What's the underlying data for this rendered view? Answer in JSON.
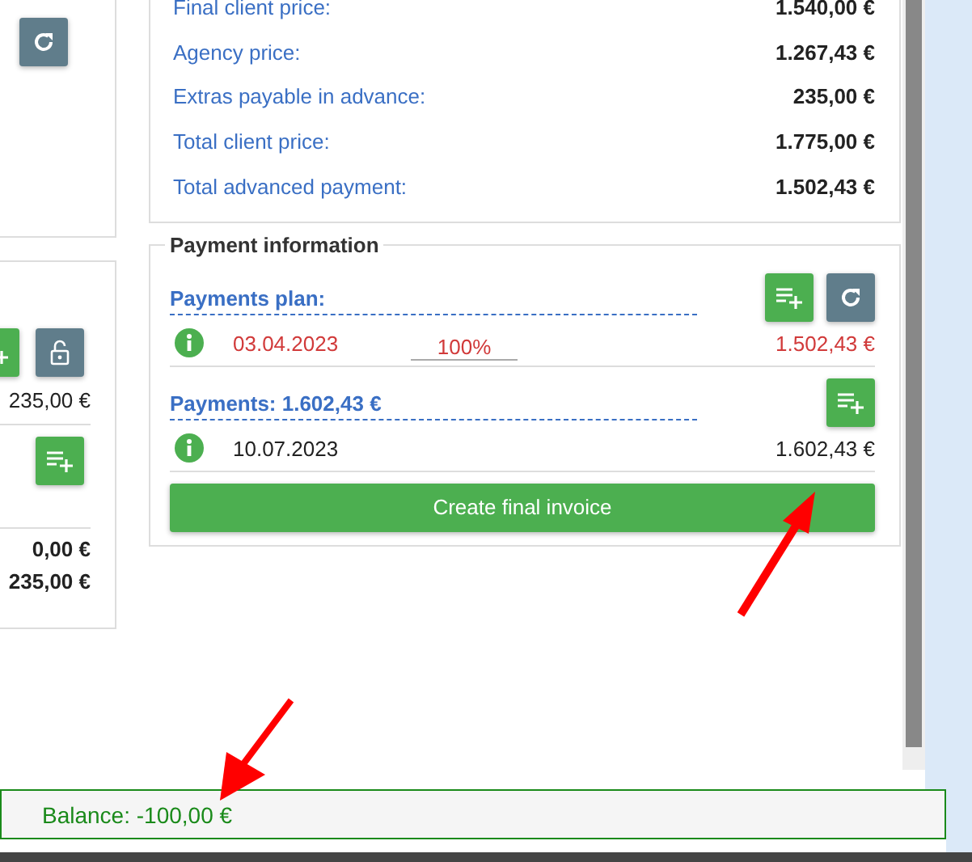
{
  "left_panel": {
    "amount": "235,00 €",
    "totals": [
      "0,00 €",
      "235,00 €"
    ]
  },
  "summary": {
    "rows": [
      {
        "label": "Final client price:",
        "value": "1.540,00 €"
      },
      {
        "label": "Agency price:",
        "value": "1.267,43 €"
      },
      {
        "label": "Extras payable in advance:",
        "value": "235,00 €"
      },
      {
        "label": "Total client price:",
        "value": "1.775,00 €"
      },
      {
        "label": "Total advanced payment:",
        "value": "1.502,43 €"
      }
    ]
  },
  "payment_information": {
    "title": "Payment information",
    "payments_plan": {
      "title": "Payments plan:",
      "entries": [
        {
          "date": "03.04.2023",
          "percent": "100%",
          "amount": "1.502,43 €",
          "alert": true
        }
      ]
    },
    "payments": {
      "title": "Payments: 1.602,43 €",
      "entries": [
        {
          "date": "10.07.2023",
          "amount": "1.602,43 €",
          "alert": false
        }
      ]
    },
    "button": "Create final invoice"
  },
  "balance": "Balance: -100,00 €"
}
